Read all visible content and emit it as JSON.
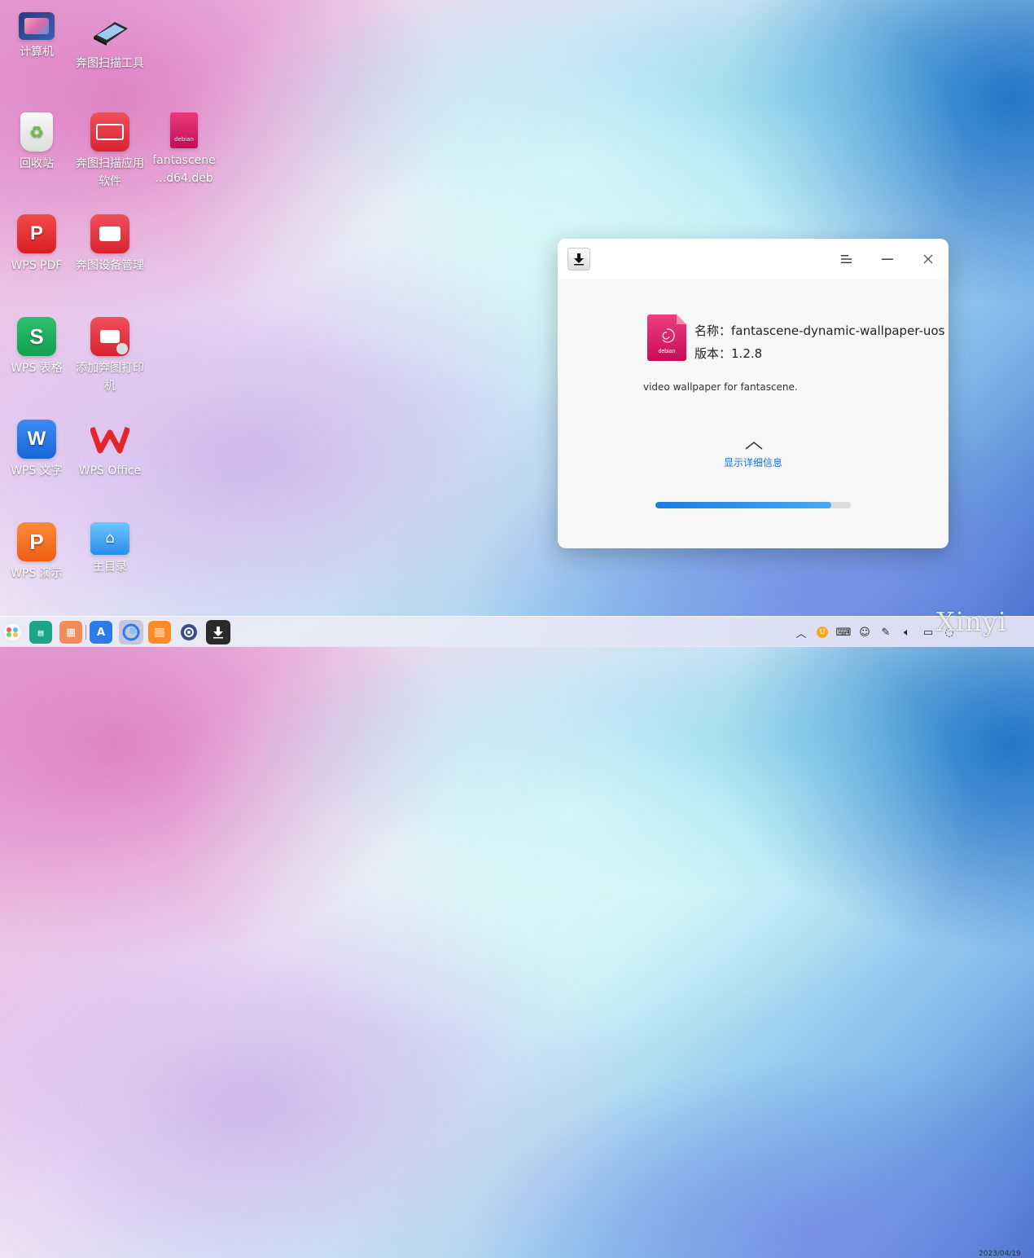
{
  "desktop": {
    "icons": [
      {
        "label": "计算机",
        "icon": "computer-icon"
      },
      {
        "label": "奔图扫描工具",
        "icon": "scanner-icon"
      },
      {
        "label": "回收站",
        "icon": "trash-icon"
      },
      {
        "label": "奔图扫描应用软件",
        "icon": "pantum-scan-app-icon"
      },
      {
        "label": "fantascene\n…d64.deb",
        "icon": "deb-file-icon"
      },
      {
        "label": "WPS PDF",
        "icon": "wps-pdf-icon"
      },
      {
        "label": "奔图设备管理",
        "icon": "pantum-device-manager-icon"
      },
      {
        "label": "WPS 表格",
        "icon": "wps-spreadsheet-icon"
      },
      {
        "label": "添加奔图打印机",
        "icon": "add-pantum-printer-icon"
      },
      {
        "label": "WPS 文字",
        "icon": "wps-writer-icon"
      },
      {
        "label": "WPS Office",
        "icon": "wps-office-icon"
      },
      {
        "label": "WPS 演示",
        "icon": "wps-presentation-icon"
      },
      {
        "label": "主目录",
        "icon": "home-folder-icon"
      }
    ]
  },
  "installer": {
    "name_label": "名称：",
    "name_value": "fantascene-dynamic-wallpaper-uos",
    "version_label": "版本：",
    "version_value": "1.2.8",
    "description": "video wallpaper for fantascene.",
    "details_toggle": "显示详细信息",
    "progress": 0.9,
    "package_badge": "debian",
    "colors": {
      "accent": "#1b7de2",
      "debian": "#d8105d"
    }
  },
  "taskbar": {
    "items": [
      "launcher-icon",
      "terminal-icon",
      "multitasking-icon",
      "app-store-icon",
      "browser-icon",
      "gift-icon",
      "settings-icon",
      "package-installer-icon"
    ],
    "tray": [
      "expand-tray-icon",
      "input-method-icon",
      "keyboard-icon",
      "qq-icon",
      "pen-icon",
      "volume-icon",
      "battery-icon",
      "network-icon"
    ],
    "date": "2023/04/19"
  },
  "watermark": "Xinyi"
}
